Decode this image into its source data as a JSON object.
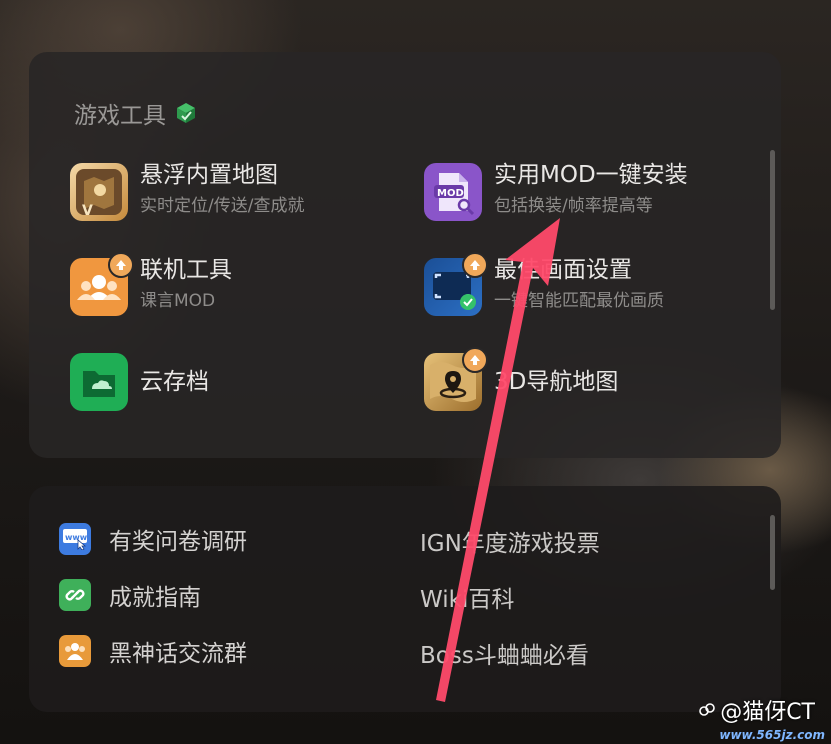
{
  "section": {
    "title": "游戏工具",
    "icon": "cube-icon"
  },
  "tools": [
    {
      "title": "悬浮内置地图",
      "subtitle": "实时定位/传送/查成就",
      "icon": "map-icon",
      "color": "#c58a3c"
    },
    {
      "title": "实用MOD一键安装",
      "subtitle": "包括换装/帧率提高等",
      "icon": "mod-file-icon",
      "color": "#8a55c9"
    },
    {
      "title": "联机工具",
      "subtitle": "课言MOD",
      "icon": "users-icon",
      "color": "#f0973f"
    },
    {
      "title": "最佳画面设置",
      "subtitle": "一键智能匹配最优画质",
      "icon": "screen-settings-icon",
      "color": "#2c6fc4"
    },
    {
      "title": "云存档",
      "subtitle": "",
      "icon": "cloud-folder-icon",
      "color": "#1fae55"
    },
    {
      "title": "3D导航地图",
      "subtitle": "",
      "icon": "navigation-map-icon",
      "color": "#b88a3a"
    }
  ],
  "links": [
    {
      "label": "有奖问卷调研",
      "icon": "www-icon",
      "color": "#3d7be0"
    },
    {
      "label": "成就指南",
      "icon": "link-icon",
      "color": "#3fb05a"
    },
    {
      "label": "黑神话交流群",
      "icon": "group-icon",
      "color": "#e89a3a"
    }
  ],
  "plain_links": [
    "IGN年度游戏投票",
    "Wiki百科",
    "Boss斗蛐蛐必看"
  ],
  "watermark": {
    "text": "@猫伢CT",
    "site": "www.565jz.com"
  },
  "annotation_color": "#ff4a6a"
}
